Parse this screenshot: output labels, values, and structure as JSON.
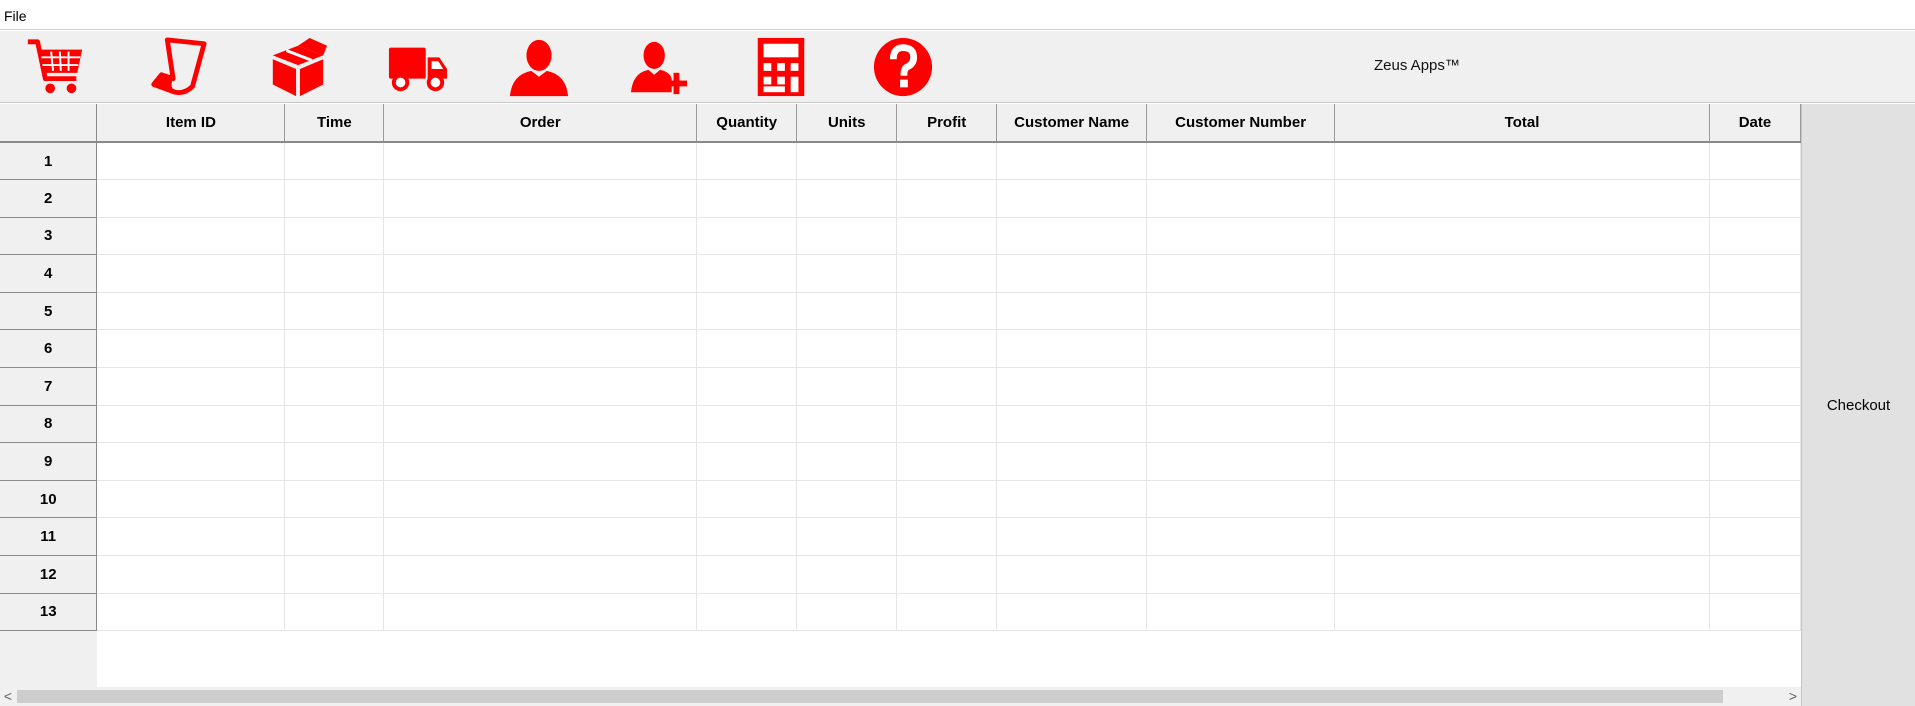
{
  "menu": {
    "file_label": "File"
  },
  "toolbar": {
    "brand": "Zeus Apps™",
    "accent_color": "#ff0000",
    "icons": [
      "cart-icon",
      "receipt-icon",
      "box-icon",
      "truck-icon",
      "user-icon",
      "add-user-icon",
      "calculator-icon",
      "help-icon"
    ]
  },
  "table": {
    "columns": [
      "Item ID",
      "Time",
      "Order",
      "Quantity",
      "Units",
      "Profit",
      "Customer Name",
      "Customer Number",
      "Total",
      "Date"
    ],
    "rows": [
      "1",
      "2",
      "3",
      "4",
      "5",
      "6",
      "7",
      "8",
      "9",
      "10",
      "11",
      "12",
      "13"
    ]
  },
  "checkout": {
    "label": "Checkout"
  },
  "scrollbar": {
    "left_arrow": "<",
    "right_arrow": ">"
  }
}
